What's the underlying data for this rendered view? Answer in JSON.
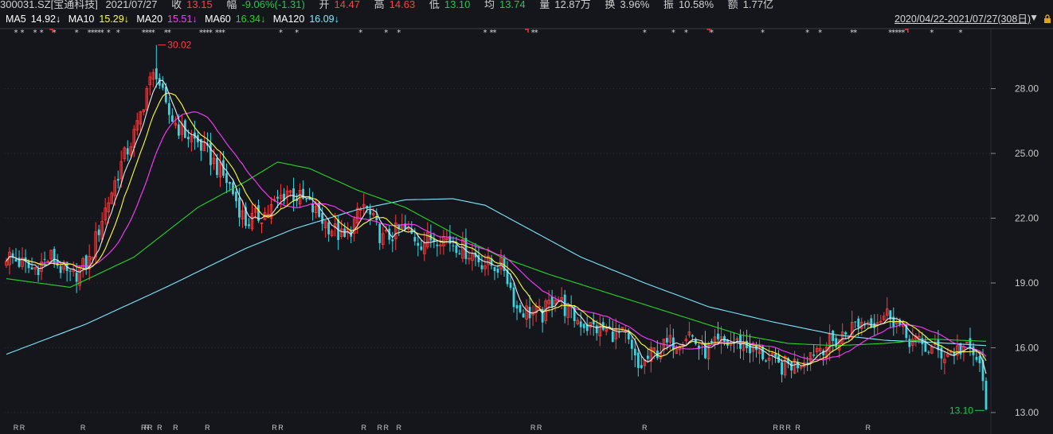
{
  "header": {
    "code": "300031.SZ[宝通科技]",
    "date": "2021/07/27",
    "close_label": "收",
    "close_value": "13.15",
    "change_label": "幅",
    "change_value": "-9.06%(-1.31)",
    "open_label": "开",
    "open_value": "14.47",
    "high_label": "高",
    "high_value": "14.63",
    "low_label": "低",
    "low_value": "13.10",
    "avg_label": "均",
    "avg_value": "13.74",
    "volume_label": "量",
    "volume_value": "12.87万",
    "turnover_label": "换",
    "turnover_value": "3.96%",
    "amplitude_label": "振",
    "amplitude_value": "10.58%",
    "amount_label": "额",
    "amount_value": "1.77亿"
  },
  "ma_legend": [
    {
      "label": "MA5",
      "value": "14.92↓",
      "color": "#ffffff"
    },
    {
      "label": "MA10",
      "value": "15.29↓",
      "color": "#ffff3c"
    },
    {
      "label": "MA20",
      "value": "15.51↓",
      "color": "#ff3cff"
    },
    {
      "label": "MA60",
      "value": "16.34↓",
      "color": "#2ad42a"
    },
    {
      "label": "MA120",
      "value": "16.09↓",
      "color": "#7fe8ff"
    }
  ],
  "range_label": "2020/04/22-2021/07/27(308日)",
  "colors": {
    "up": "#ff3b3b",
    "down": "#3fd2e0",
    "ma5": "#e8e8e8",
    "ma10": "#ffff3c",
    "ma20": "#ff3cff",
    "ma60": "#2ad42a",
    "ma120": "#7fe8ff",
    "grid": "#2a2f3a",
    "high_annot": "#ff4040",
    "low_annot": "#1fc84a"
  },
  "chart_data": {
    "type": "candlestick",
    "sessions": 308,
    "start_date": "2020/04/22",
    "end_date": "2021/07/27",
    "y_ticks": [
      "13.00",
      "16.00",
      "19.00",
      "22.00",
      "25.00",
      "28.00"
    ],
    "ylim": [
      13.0,
      30.5
    ],
    "grid": true,
    "annotations": {
      "high": {
        "label": "30.02",
        "value": 30.02,
        "session": 47
      },
      "low": {
        "label": "13.10",
        "value": 13.1,
        "session": 307
      }
    },
    "close_keypoints": [
      [
        0,
        20.3
      ],
      [
        8,
        19.6
      ],
      [
        14,
        20.2
      ],
      [
        20,
        19.2
      ],
      [
        26,
        20.0
      ],
      [
        30,
        22.0
      ],
      [
        36,
        24.5
      ],
      [
        41,
        26.2
      ],
      [
        44,
        28.0
      ],
      [
        47,
        28.8
      ],
      [
        50,
        27.0
      ],
      [
        55,
        26.0
      ],
      [
        60,
        25.5
      ],
      [
        65,
        24.6
      ],
      [
        70,
        23.5
      ],
      [
        75,
        21.8
      ],
      [
        82,
        22.3
      ],
      [
        88,
        23.3
      ],
      [
        94,
        22.7
      ],
      [
        100,
        21.8
      ],
      [
        106,
        21.0
      ],
      [
        112,
        22.6
      ],
      [
        118,
        21.0
      ],
      [
        124,
        21.5
      ],
      [
        130,
        20.9
      ],
      [
        136,
        21.2
      ],
      [
        142,
        20.7
      ],
      [
        150,
        19.9
      ],
      [
        156,
        19.7
      ],
      [
        160,
        17.8
      ],
      [
        168,
        17.5
      ],
      [
        172,
        18.5
      ],
      [
        176,
        17.6
      ],
      [
        182,
        17.0
      ],
      [
        188,
        16.8
      ],
      [
        194,
        16.5
      ],
      [
        198,
        15.0
      ],
      [
        203,
        15.8
      ],
      [
        208,
        16.2
      ],
      [
        214,
        16.7
      ],
      [
        218,
        15.8
      ],
      [
        224,
        16.2
      ],
      [
        230,
        16.2
      ],
      [
        236,
        15.8
      ],
      [
        242,
        15.1
      ],
      [
        248,
        15.3
      ],
      [
        254,
        16.0
      ],
      [
        260,
        16.3
      ],
      [
        266,
        17.1
      ],
      [
        272,
        17.3
      ],
      [
        277,
        17.6
      ],
      [
        282,
        16.5
      ],
      [
        288,
        16.0
      ],
      [
        294,
        15.7
      ],
      [
        300,
        16.0
      ],
      [
        304,
        15.5
      ],
      [
        306,
        14.46
      ],
      [
        307,
        13.15
      ]
    ],
    "ma_keypoints": {
      "MA60": [
        [
          0,
          19.2
        ],
        [
          20,
          18.8
        ],
        [
          40,
          20.2
        ],
        [
          60,
          22.5
        ],
        [
          75,
          23.7
        ],
        [
          85,
          24.6
        ],
        [
          95,
          24.3
        ],
        [
          110,
          23.3
        ],
        [
          125,
          22.5
        ],
        [
          140,
          21.3
        ],
        [
          155,
          20.2
        ],
        [
          170,
          19.4
        ],
        [
          185,
          18.7
        ],
        [
          200,
          18.0
        ],
        [
          215,
          17.3
        ],
        [
          230,
          16.6
        ],
        [
          245,
          16.2
        ],
        [
          260,
          16.1
        ],
        [
          275,
          16.2
        ],
        [
          290,
          16.4
        ],
        [
          307,
          16.3
        ]
      ],
      "MA120": [
        [
          0,
          15.7
        ],
        [
          25,
          17.1
        ],
        [
          50,
          18.8
        ],
        [
          75,
          20.6
        ],
        [
          90,
          21.5
        ],
        [
          110,
          22.4
        ],
        [
          125,
          22.85
        ],
        [
          140,
          22.9
        ],
        [
          150,
          22.6
        ],
        [
          165,
          21.4
        ],
        [
          180,
          20.2
        ],
        [
          200,
          19.0
        ],
        [
          220,
          17.9
        ],
        [
          240,
          17.2
        ],
        [
          260,
          16.6
        ],
        [
          275,
          16.35
        ],
        [
          290,
          16.25
        ],
        [
          307,
          16.1
        ]
      ]
    },
    "marker_rows": {
      "star_sessions": [
        3,
        5,
        9,
        11,
        15,
        22,
        26,
        27,
        28,
        29,
        30,
        32,
        35,
        43,
        44,
        45,
        46,
        50,
        51,
        61,
        62,
        63,
        64,
        66,
        67,
        68,
        86,
        91,
        111,
        119,
        123,
        150,
        152,
        153,
        165,
        166,
        200,
        209,
        213,
        221,
        237,
        251,
        255,
        265,
        266,
        277,
        278,
        279,
        280,
        281,
        290,
        299
      ],
      "flag_sessions": [
        14,
        163,
        220,
        282
      ],
      "r_sessions": [
        3,
        5,
        24,
        43,
        44,
        45,
        48,
        53,
        63,
        84,
        86,
        112,
        117,
        119,
        123,
        165,
        167,
        200,
        241,
        243,
        245,
        248,
        270
      ]
    }
  }
}
